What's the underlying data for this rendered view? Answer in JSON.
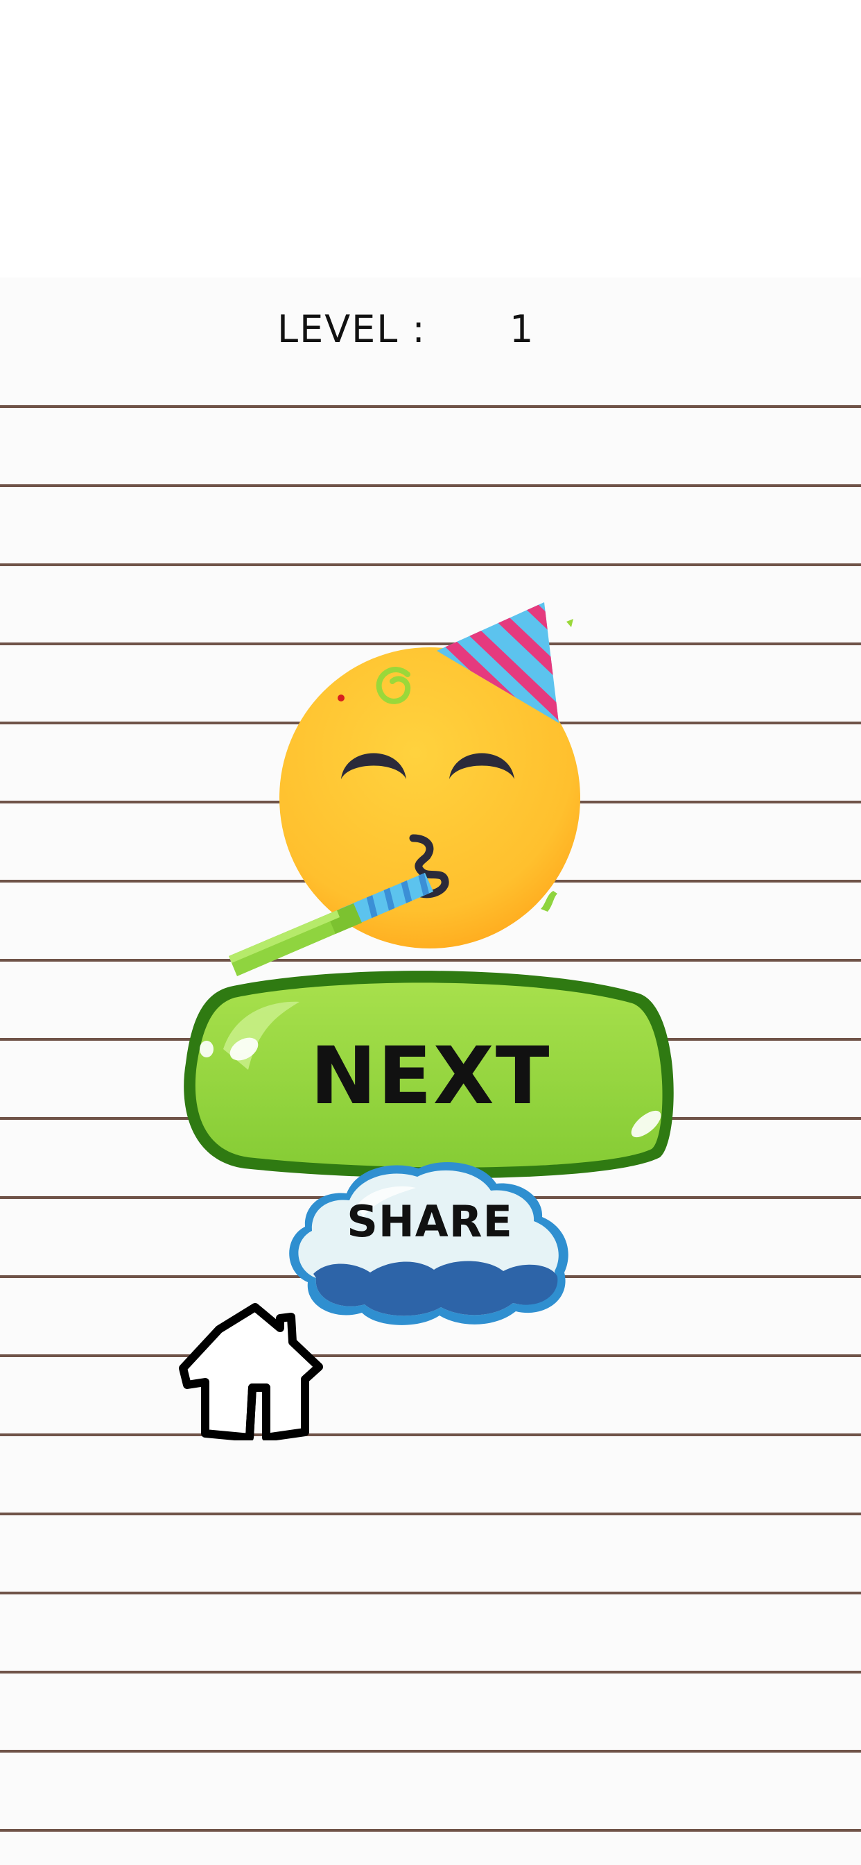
{
  "level": {
    "label": "LEVEL :",
    "value": "1"
  },
  "buttons": {
    "next_label": "NEXT",
    "share_label": "SHARE",
    "home_icon": "home-icon"
  },
  "emoji": {
    "name": "partying-face-icon"
  },
  "colors": {
    "next_green": "#8fd43f",
    "next_border": "#2f7a12",
    "share_sky": "#e6f3f6",
    "share_blue": "#2f63a8",
    "rule_brown": "#6f5348",
    "face_yellow": "#ffc533"
  }
}
